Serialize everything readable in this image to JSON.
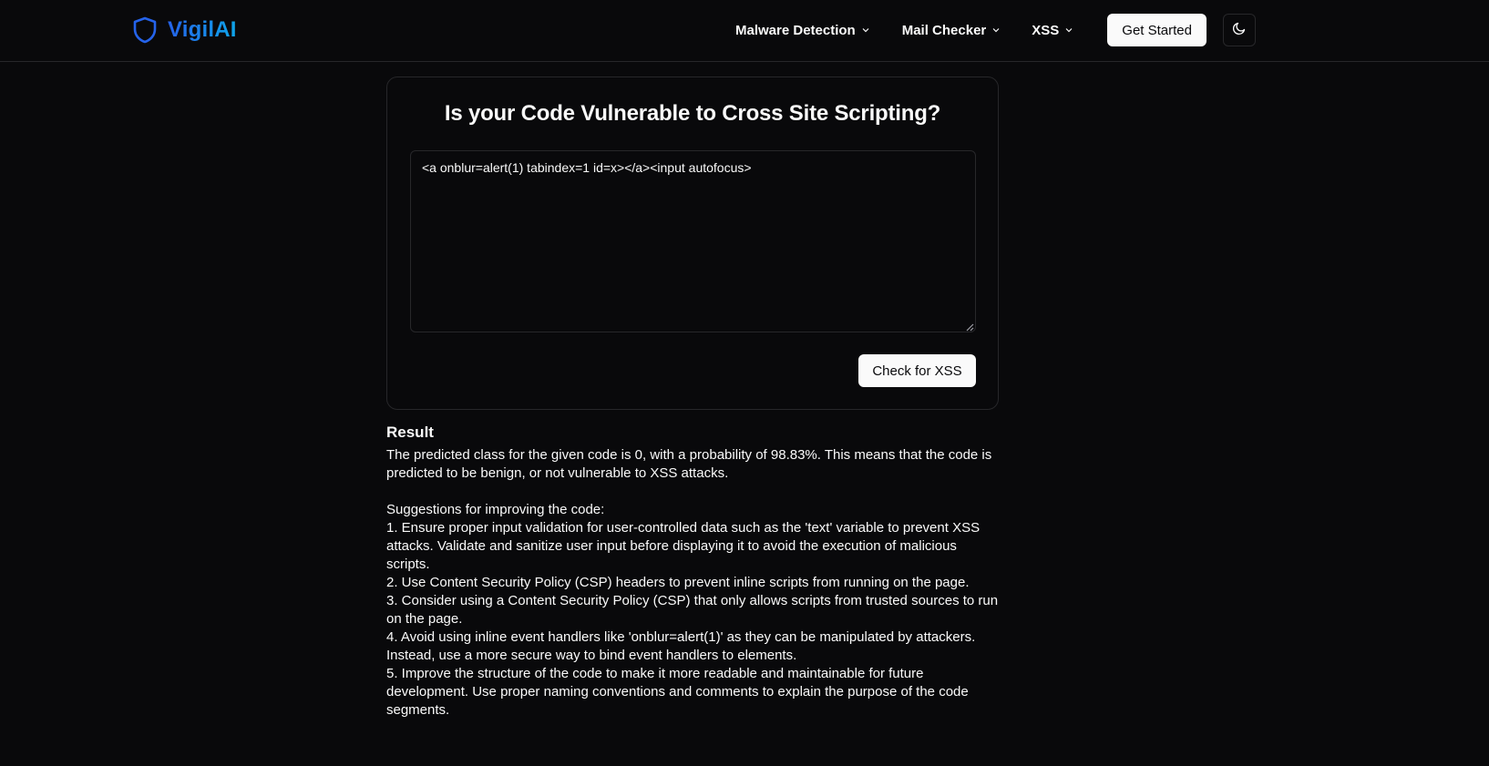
{
  "header": {
    "brand_name": "VigilAI",
    "nav": [
      {
        "label": "Malware Detection"
      },
      {
        "label": "Mail Checker"
      },
      {
        "label": "XSS"
      }
    ],
    "cta_label": "Get Started",
    "theme_icon": "moon-icon"
  },
  "card": {
    "title": "Is your Code Vulnerable to Cross Site Scripting?",
    "code_value": "<a onblur=alert(1) tabindex=1 id=x></a><input autofocus>",
    "check_label": "Check for XSS"
  },
  "result": {
    "heading": "Result",
    "summary": [
      "The predicted class for the given code is 0, with a probability of 98.83%. This means that the code is",
      "predicted to be benign, or not vulnerable to XSS attacks."
    ],
    "suggestions_lines": [
      "Suggestions for improving the code:",
      "1. Ensure proper input validation for user-controlled data such as the 'text' variable to prevent XSS",
      "attacks. Validate and sanitize user input before displaying it to avoid the execution of malicious",
      "scripts.",
      "2. Use Content Security Policy (CSP) headers to prevent inline scripts from running on the page.",
      "3. Consider using a Content Security Policy (CSP) that only allows scripts from trusted sources to run",
      "on the page.",
      "4. Avoid using inline event handlers like 'onblur=alert(1)' as they can be manipulated by attackers.",
      "Instead, use a more secure way to bind event handlers to elements.",
      "5. Improve the structure of the code to make it more readable and maintainable for future",
      "development. Use proper naming conventions and comments to explain the purpose of the code",
      "segments."
    ]
  },
  "colors": {
    "background": "#09090b",
    "border": "#27272a",
    "brand_blue": "#2563eb",
    "text": "#fafafa"
  }
}
